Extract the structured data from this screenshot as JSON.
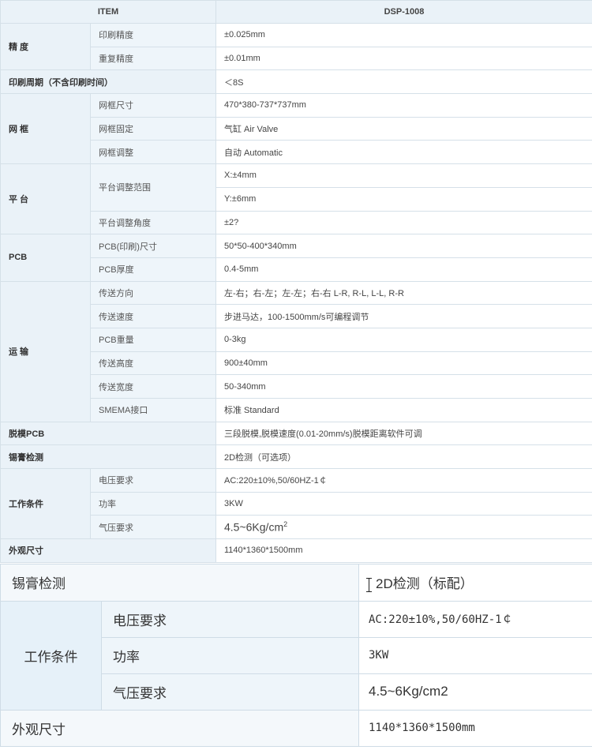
{
  "spec": {
    "header": {
      "item": "ITEM",
      "model": "DSP-1008"
    },
    "precision": {
      "cat": "精 度",
      "print_label": "印刷精度",
      "print_value": "±0.025mm",
      "repeat_label": "重复精度",
      "repeat_value": "±0.01mm"
    },
    "cycle": {
      "label": "印刷周期（不含印刷时间）",
      "value": "＜8S"
    },
    "frame": {
      "cat": "网 框",
      "size_label": "网框尺寸",
      "size_value": "470*380-737*737mm",
      "fix_label": "网框固定",
      "fix_value": "气缸 Air Valve",
      "adjust_label": "网框调整",
      "adjust_value": "自动 Automatic"
    },
    "platform": {
      "cat": "平 台",
      "range_label": "平台调整范围",
      "range_x": "X:±4mm",
      "range_y": "Y:±6mm",
      "angle_label": "平台调整角度",
      "angle_value": "±2?"
    },
    "pcb": {
      "cat": "PCB",
      "size_label": "PCB(印刷)尺寸",
      "size_value": "50*50-400*340mm",
      "thick_label": "PCB厚度",
      "thick_value": "0.4-5mm"
    },
    "transport": {
      "cat": "运 输",
      "dir_label": "传送方向",
      "dir_value": "左-右；右-左；左-左；右-右 L-R, R-L, L-L, R-R",
      "speed_label": "传送速度",
      "speed_value": "步进马达，100-1500mm/s可编程调节",
      "weight_label": "PCB重量",
      "weight_value": "0-3kg",
      "height_label": "传送高度",
      "height_value": "900±40mm",
      "width_label": "传送宽度",
      "width_value": "50-340mm",
      "smema_label": "SMEMA接口",
      "smema_value": "标准 Standard"
    },
    "demold": {
      "label": "脱模PCB",
      "value": "三段脱模,脱模速度(0.01-20mm/s)脱模距离软件可调"
    },
    "inspect": {
      "label": "锡膏检测",
      "value": "2D检测（可选项）"
    },
    "work": {
      "cat": "工作条件",
      "voltage_label": "电压要求",
      "voltage_value": "AC:220±10%,50/60HZ-1￠",
      "power_label": "功率",
      "power_value": "3KW",
      "air_label": "气压要求",
      "air_value": "4.5~6Kg/cm",
      "air_sup": "2"
    },
    "dims": {
      "label": "外观尺寸",
      "value": "1140*1360*1500mm"
    }
  },
  "zoom": {
    "inspect_label": "锡膏检测",
    "inspect_value": "2D检测（标配）",
    "work_cat": "工作条件",
    "voltage_label": "电压要求",
    "voltage_value": "AC:220±10%,50/60HZ-1￠",
    "power_label": "功率",
    "power_value": "3KW",
    "air_label": "气压要求",
    "air_value": "4.5~6Kg/cm2",
    "dims_label": "外观尺寸",
    "dims_value": "1140*1360*1500mm"
  }
}
